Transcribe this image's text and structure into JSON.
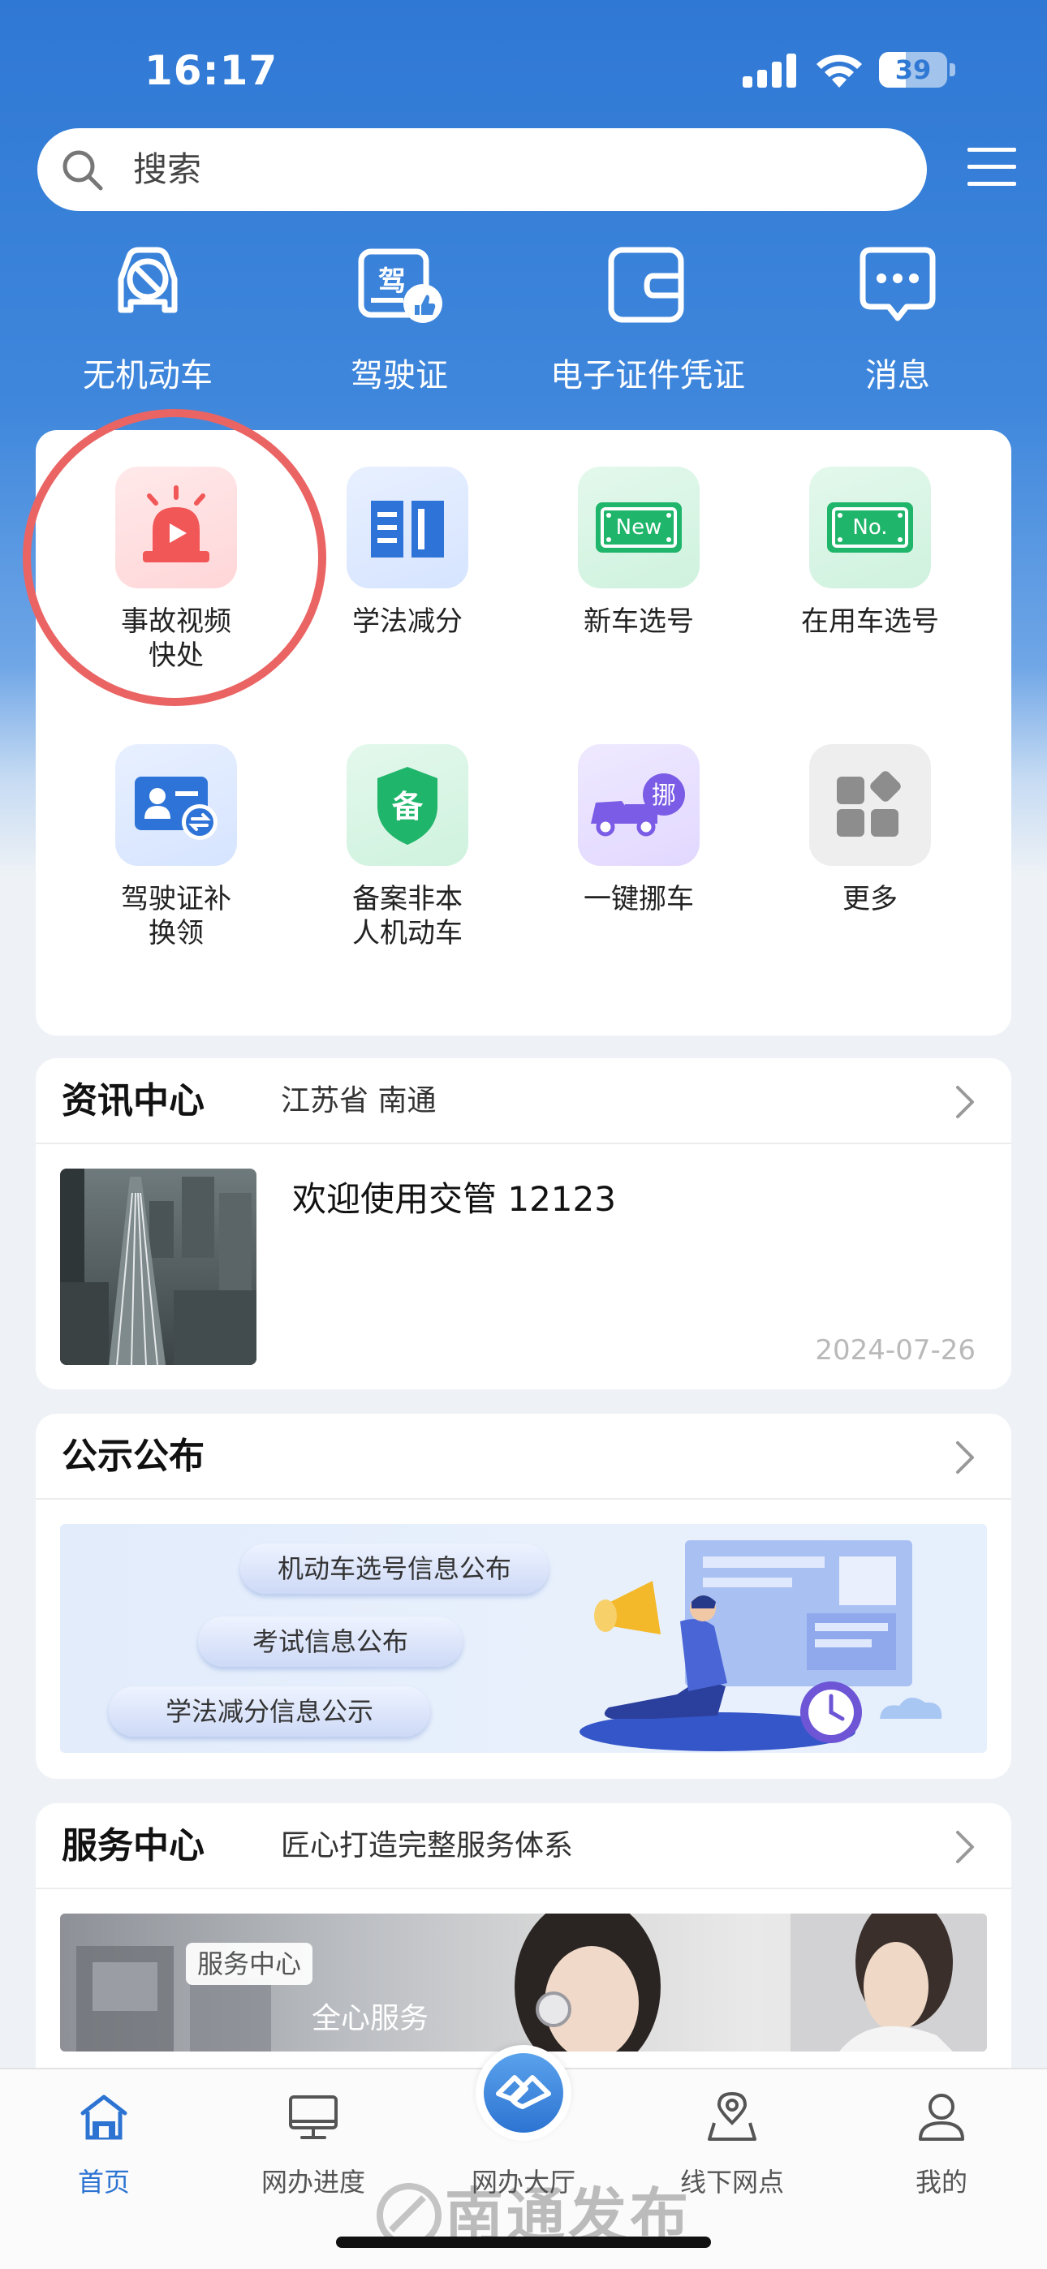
{
  "status_bar": {
    "time": "16:17",
    "battery": "39",
    "battery_level": 0.39
  },
  "search": {
    "placeholder": "搜索"
  },
  "shortcuts": [
    {
      "label": "无机动车",
      "icon": "car-slash-icon"
    },
    {
      "label": "驾驶证",
      "icon": "license-like-icon"
    },
    {
      "label": "电子证件凭证",
      "icon": "wallet-icon"
    },
    {
      "label": "消息",
      "icon": "chat-bubble-icon"
    }
  ],
  "services": [
    {
      "label": "事故视频\n快处",
      "icon": "siren-video-icon"
    },
    {
      "label": "学法减分",
      "icon": "open-book-icon"
    },
    {
      "label": "新车选号",
      "icon": "new-plate-icon",
      "badge": "New"
    },
    {
      "label": "在用车选号",
      "icon": "no-plate-icon",
      "badge": "No."
    },
    {
      "label": "驾驶证补\n换领",
      "icon": "id-card-swap-icon"
    },
    {
      "label": "备案非本\n人机动车",
      "icon": "shield-filing-icon",
      "badge": "备"
    },
    {
      "label": "一键挪车",
      "icon": "truck-move-icon",
      "badge": "挪"
    },
    {
      "label": "更多",
      "icon": "grid-more-icon"
    }
  ],
  "news": {
    "title": "资讯中心",
    "region": "江苏省 南通",
    "item_title": "欢迎使用交管 12123",
    "item_date": "2024-07-26"
  },
  "notice": {
    "title": "公示公布",
    "pills": [
      "机动车选号信息公布",
      "考试信息公布",
      "学法减分信息公示"
    ]
  },
  "service_center": {
    "title": "服务中心",
    "subtitle": "匠心打造完整服务体系",
    "tag": "服务中心",
    "slogan": "全心服务"
  },
  "tabs": [
    {
      "label": "首页",
      "icon": "home-icon",
      "active": true
    },
    {
      "label": "网办进度",
      "icon": "monitor-icon"
    },
    {
      "label": "网办大厅",
      "icon": "handshake-icon"
    },
    {
      "label": "线下网点",
      "icon": "map-pin-icon"
    },
    {
      "label": "我的",
      "icon": "user-icon"
    }
  ],
  "watermark": "南通发布",
  "colors": {
    "primary": "#2f78d4",
    "accent_red": "#ea6464",
    "tab_active": "#2d74d2"
  }
}
